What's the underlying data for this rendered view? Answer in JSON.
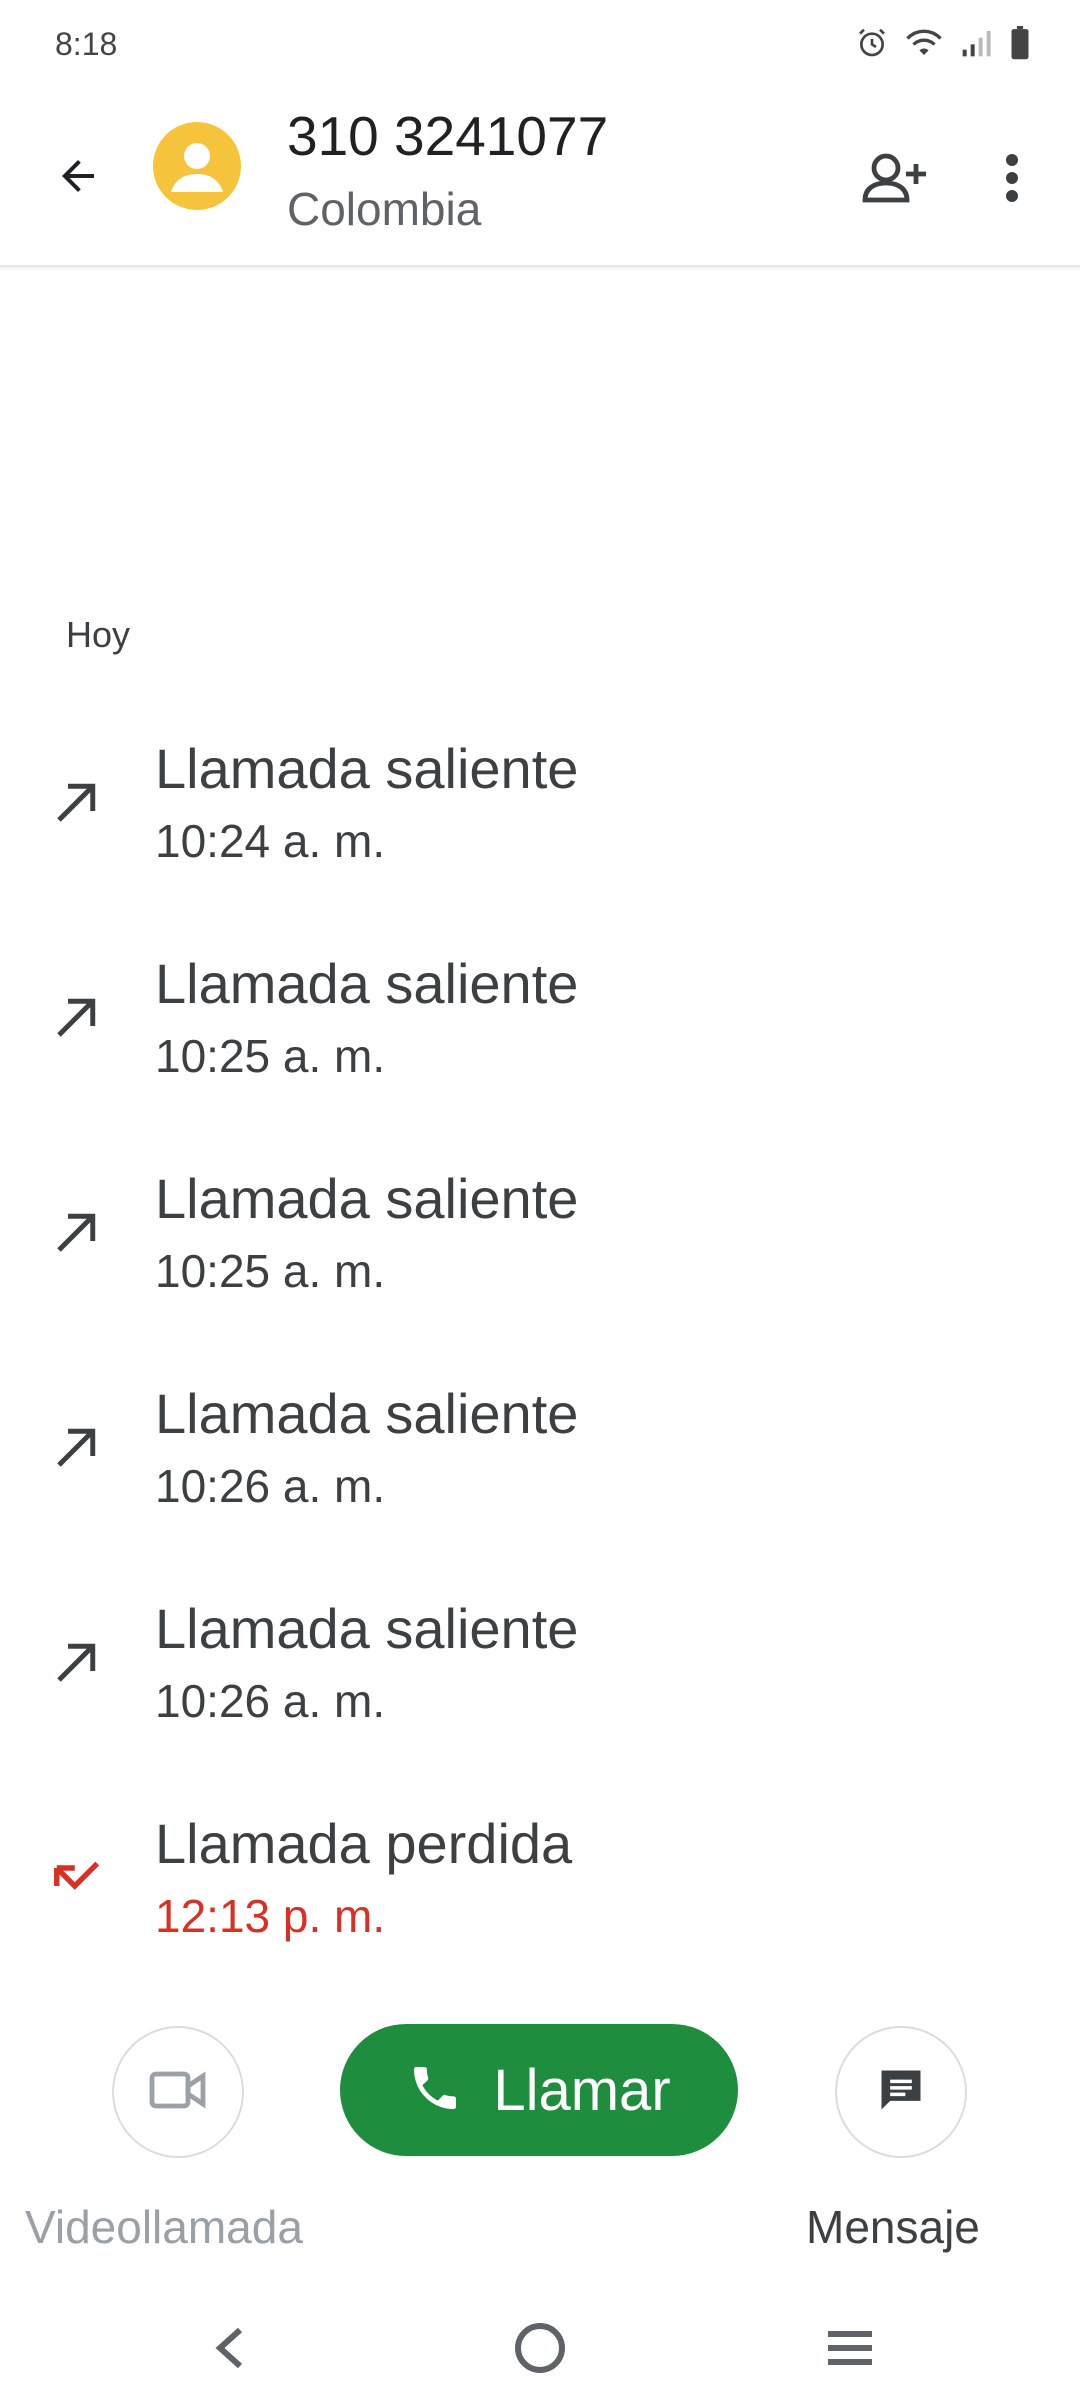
{
  "status_bar": {
    "time": "8:18",
    "icons": [
      "alarm-icon",
      "wifi-icon",
      "signal-icon",
      "battery-icon"
    ]
  },
  "header": {
    "number": "310 3241077",
    "country": "Colombia"
  },
  "section": {
    "label": "Hoy"
  },
  "calls": [
    {
      "type": "Llamada saliente",
      "time": "10:24 a. m.",
      "direction": "outgoing"
    },
    {
      "type": "Llamada saliente",
      "time": "10:25 a. m.",
      "direction": "outgoing"
    },
    {
      "type": "Llamada saliente",
      "time": "10:25 a. m.",
      "direction": "outgoing"
    },
    {
      "type": "Llamada saliente",
      "time": "10:26 a. m.",
      "direction": "outgoing"
    },
    {
      "type": "Llamada saliente",
      "time": "10:26 a. m.",
      "direction": "outgoing"
    },
    {
      "type": "Llamada perdida",
      "time": "12:13 p. m.",
      "direction": "missed"
    }
  ],
  "actions": {
    "video_label": "Videollamada",
    "call_label": "Llamar",
    "message_label": "Mensaje"
  },
  "colors": {
    "accent_green": "#1e8e3e",
    "missed_red": "#d93025",
    "avatar_yellow": "#f6c33d"
  }
}
